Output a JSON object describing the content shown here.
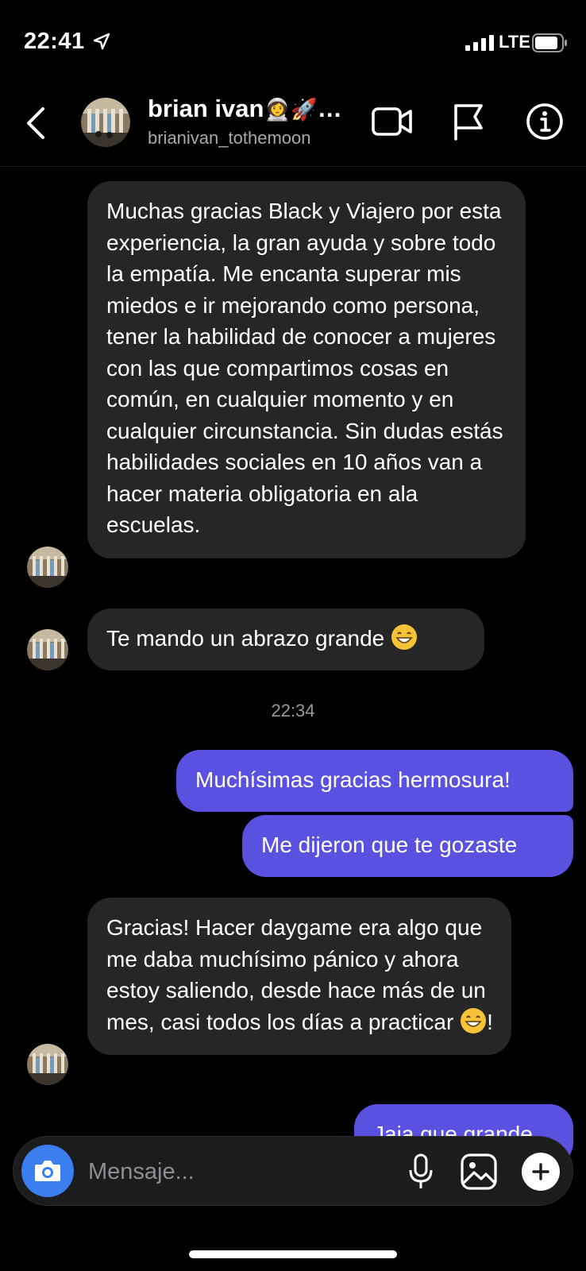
{
  "status_bar": {
    "time": "22:41",
    "network": "LTE",
    "icons": [
      "location-arrow-icon",
      "signal-bars-icon",
      "battery-icon"
    ]
  },
  "header": {
    "name": "brian ivan",
    "name_emoji": "👩‍🚀🚀",
    "name_more": "…",
    "username": "brianivan_tothemoon",
    "icons": [
      "back-chevron-icon",
      "video-call-icon",
      "flag-icon",
      "info-icon"
    ]
  },
  "messages": [
    {
      "direction": "incoming",
      "text": "Muchas gracias Black y Viajero por esta experiencia, la gran ayuda y sobre todo la empatía. Me encanta superar mis miedos e ir mejorando como persona, tener la habilidad de conocer a mujeres con las que compartimos cosas en común, en cualquier momento y en cualquier circunstancia. Sin dudas estás habilidades sociales en 10 años van a hacer materia obligatoria en ala escuelas."
    },
    {
      "direction": "incoming",
      "text": "Te mando un abrazo grande",
      "emoji": "😁"
    },
    {
      "direction": "outgoing",
      "text": "Muchísimas gracias hermosura!"
    },
    {
      "direction": "outgoing",
      "text": "Me dijeron que te gozaste"
    },
    {
      "direction": "incoming",
      "text": "Gracias! Hacer daygame era algo que me daba muchísimo pánico y ahora estoy saliendo, desde hace más de un mes, casi todos los días a practicar",
      "emoji": "😁",
      "suffix": "!"
    },
    {
      "direction": "outgoing",
      "text": "Jaja que grande"
    }
  ],
  "timestamp": "22:34",
  "composer": {
    "placeholder": "Mensaje...",
    "icons": [
      "camera-icon",
      "microphone-icon",
      "photo-gallery-icon",
      "plus-icon"
    ]
  },
  "colors": {
    "background": "#000000",
    "incoming_bubble": "#262626",
    "outgoing_bubble": "#5b51e0",
    "camera_button": "#3a7ef0",
    "secondary_text": "#a8a8a8"
  }
}
